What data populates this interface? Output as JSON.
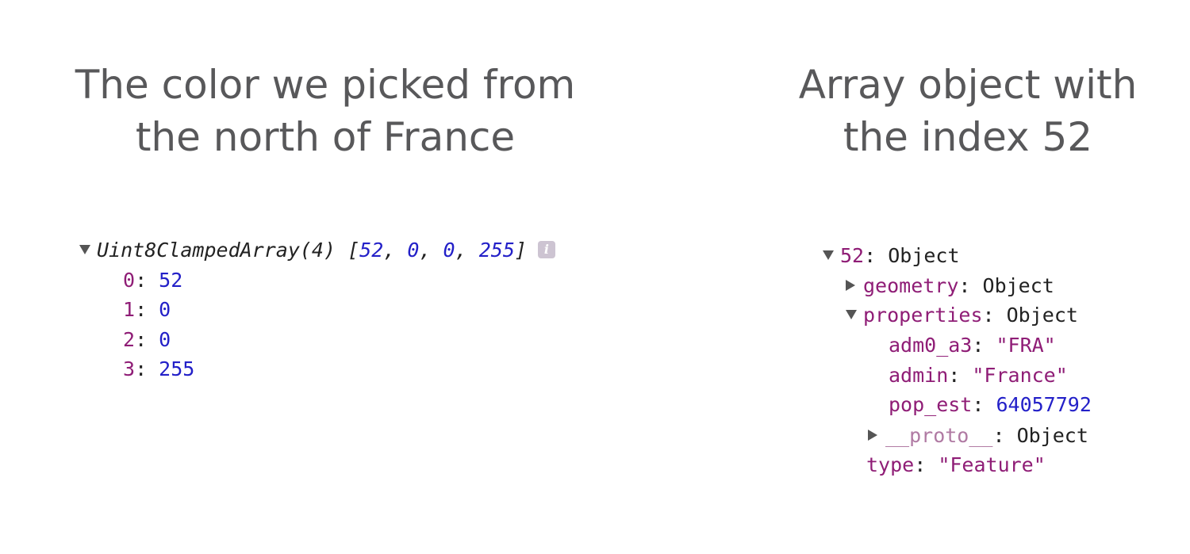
{
  "left_title": {
    "line1": "The color we picked from",
    "line2": "the north of France"
  },
  "right_title": {
    "line1": "Array object with",
    "line2": "the index 52"
  },
  "uint8_array": {
    "type_label": "Uint8ClampedArray(4)",
    "open_bracket": "[",
    "close_bracket": "]",
    "separator": ", ",
    "preview": [
      "52",
      "0",
      "0",
      "255"
    ],
    "info_icon": "info-icon",
    "entries": [
      {
        "key": "0",
        "value": "52"
      },
      {
        "key": "1",
        "value": "0"
      },
      {
        "key": "2",
        "value": "0"
      },
      {
        "key": "3",
        "value": "255"
      }
    ]
  },
  "feature_object": {
    "index": "52",
    "colon": ": ",
    "type_label": "Object",
    "geometry": {
      "key": "geometry",
      "value": "Object"
    },
    "properties": {
      "key": "properties",
      "value": "Object",
      "entries": [
        {
          "key": "adm0_a3",
          "value": "\"FRA\""
        },
        {
          "key": "admin",
          "value": "\"France\""
        },
        {
          "key": "pop_est",
          "value": "64057792"
        }
      ],
      "proto": {
        "key": "__proto__",
        "value": "Object"
      }
    },
    "type": {
      "key": "type",
      "value": "\"Feature\""
    }
  },
  "colors": {
    "heading": "#58585a",
    "key": "#8f1d76",
    "number": "#2320c8",
    "string": "#8f1d76",
    "text": "#222222"
  }
}
